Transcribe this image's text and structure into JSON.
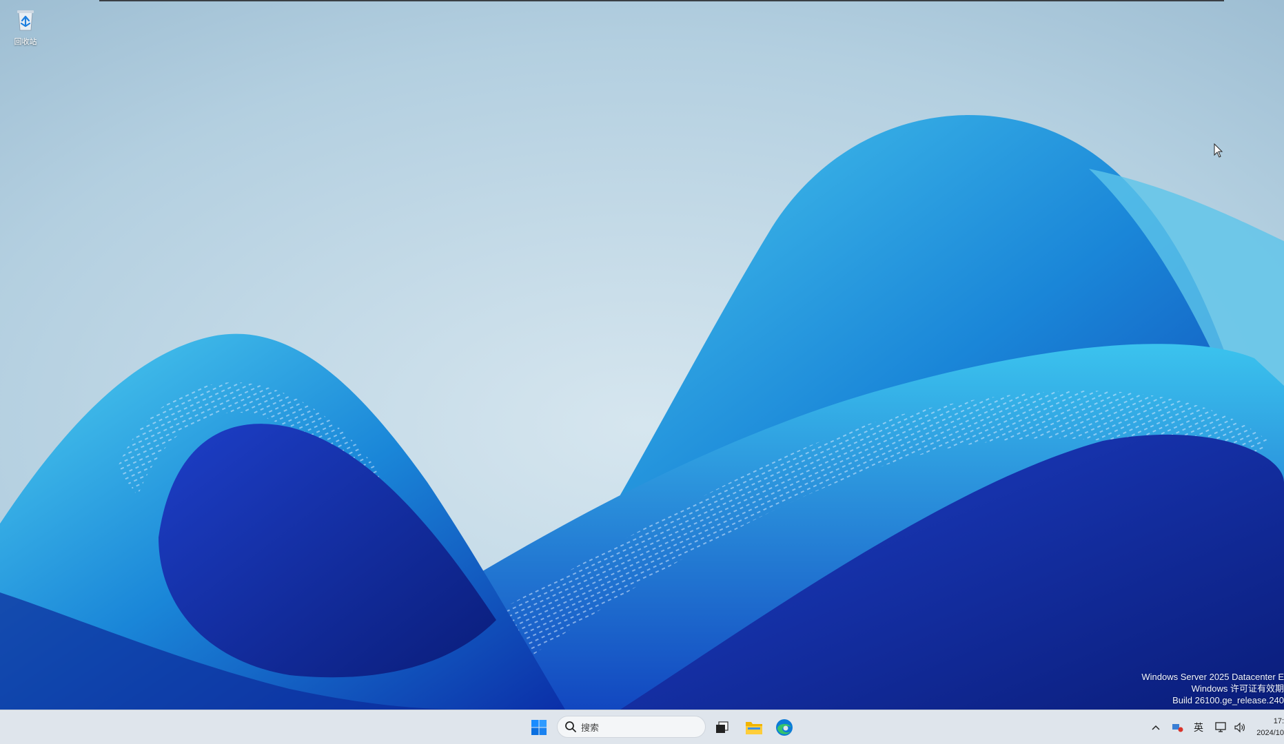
{
  "desktop": {
    "icons": [
      {
        "label": "回收站",
        "icon": "recycle-bin-icon"
      }
    ],
    "watermark": {
      "line1": "Windows Server 2025 Datacenter E",
      "line2": "Windows 许可证有效期",
      "line3": "Build 26100.ge_release.240"
    }
  },
  "taskbar": {
    "start_icon": "windows-start-icon",
    "search_placeholder": "搜索",
    "pinned": [
      {
        "name": "task-view",
        "icon": "task-view-icon"
      },
      {
        "name": "file-explorer",
        "icon": "folder-icon"
      },
      {
        "name": "edge",
        "icon": "edge-browser-icon"
      }
    ],
    "tray": {
      "chevron_icon": "chevron-up-icon",
      "network_status_icon": "network-status-icon",
      "ime_label": "英",
      "display_icon": "display-icon",
      "volume_icon": "speaker-icon"
    },
    "clock": {
      "time": "17:",
      "date": "2024/10"
    }
  },
  "colors": {
    "accent": "#0a5fd6",
    "taskbar_bg": "#dfe5ec",
    "wallpaper_sky": "#b9d4e4"
  }
}
